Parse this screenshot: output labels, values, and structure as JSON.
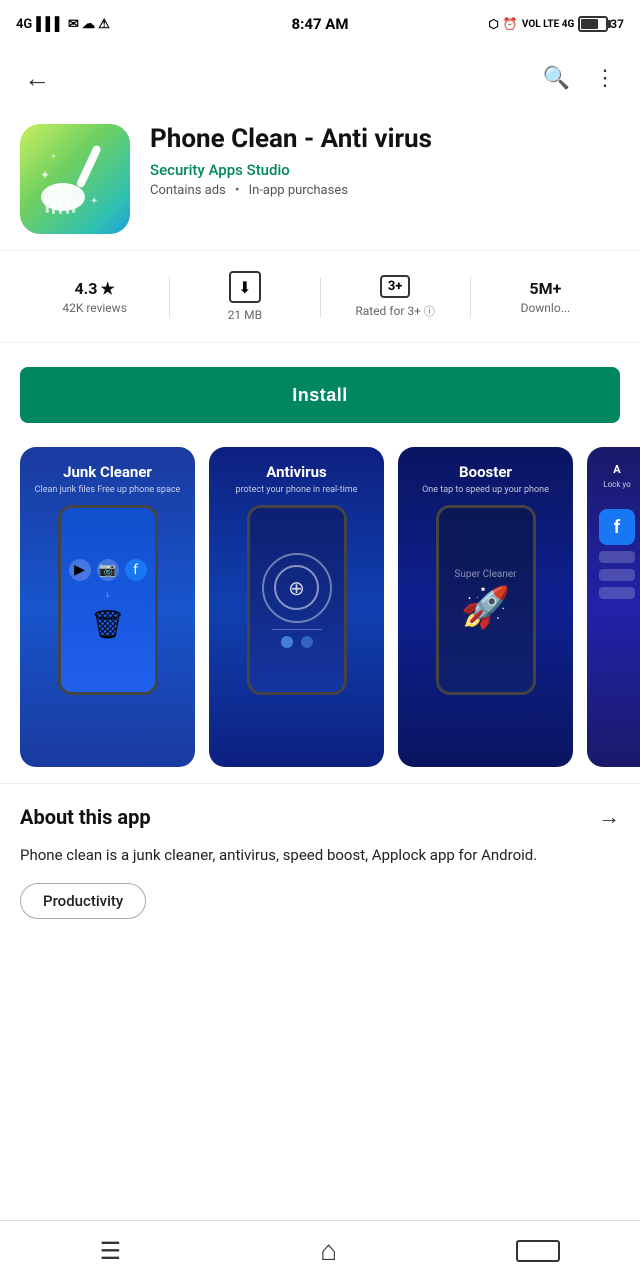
{
  "statusBar": {
    "leftText": "4G",
    "time": "8:47 AM",
    "battery": "37"
  },
  "nav": {
    "backLabel": "←",
    "searchLabel": "🔍",
    "moreLabel": "⋮"
  },
  "app": {
    "title": "Phone Clean - Anti virus",
    "developer": "Security Apps Studio",
    "meta": "Contains ads",
    "metaExtra": "In-app purchases"
  },
  "stats": {
    "rating": "4.3",
    "ratingStar": "★",
    "reviewsLabel": "42K reviews",
    "size": "21 MB",
    "sizeLabel": "21 MB",
    "ageRating": "3+",
    "ageLabel": "Rated for 3+",
    "downloads": "5M+",
    "downloadsLabel": "Downlo..."
  },
  "installButton": {
    "label": "Install"
  },
  "screenshots": [
    {
      "title": "Junk Cleaner",
      "subtitle": "Clean junk files Free up phone space",
      "type": "junk"
    },
    {
      "title": "Antivirus",
      "subtitle": "protect your phone in real-time",
      "type": "antivirus"
    },
    {
      "title": "Booster",
      "subtitle": "One tap to speed up your phone",
      "type": "booster"
    },
    {
      "title": "A...",
      "subtitle": "Lock yo...",
      "type": "applock"
    }
  ],
  "about": {
    "title": "About this app",
    "arrowLabel": "→",
    "description": "Phone clean is a junk cleaner, antivirus, speed boost, Applock app for Android.",
    "category": "Productivity"
  },
  "bottomNav": {
    "menuIcon": "☰",
    "homeIcon": "⌂",
    "backIcon": "⬛"
  }
}
